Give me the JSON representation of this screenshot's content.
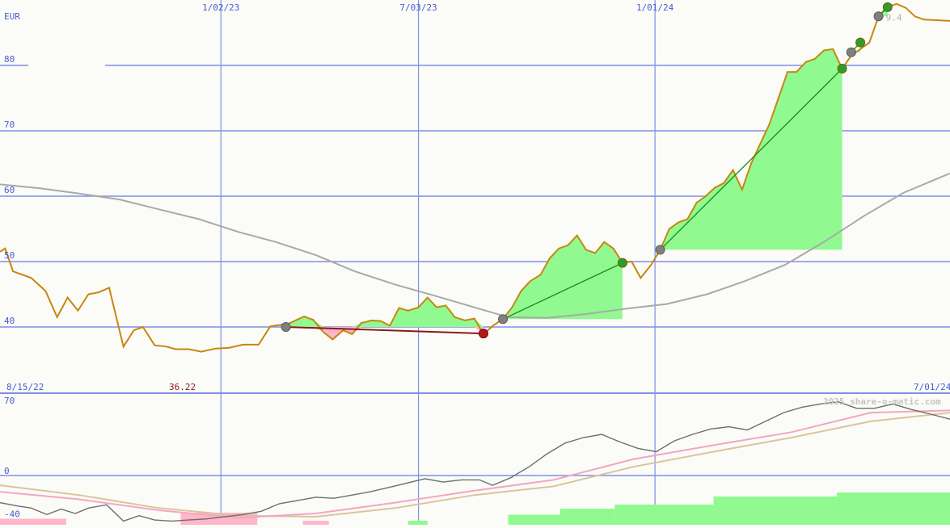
{
  "header": {
    "currency": "EUR",
    "watermark": "2025 share-o-matic.com"
  },
  "colors": {
    "grid": "#7f8fe6",
    "price": "#c8860f",
    "ma": "#a9a9a9",
    "gain_fill": "#90fa90",
    "loss_fill": "#ffb6c8",
    "gain_line": "#1a8a1a",
    "loss_line": "#8b1a1a",
    "osc_main": "#6e6e6e",
    "osc_pink": "#f4a6c0",
    "osc_tan": "#dcc49a",
    "hist_pos": "#90fa90",
    "hist_neg": "#ffb6c8",
    "label_red": "#8b1a1a"
  },
  "chart_data": [
    {
      "type": "line",
      "title": "",
      "ylabel": "EUR",
      "ylim": [
        30,
        90
      ],
      "y_ticks": [
        40,
        50,
        60,
        70,
        80
      ],
      "x_range": [
        "2022-08-15",
        "2024-08-15"
      ],
      "x_ticks": [
        {
          "date": "2023-02-01",
          "label": "1/02/23"
        },
        {
          "date": "2023-07-03",
          "label": "7/03/23"
        },
        {
          "date": "2024-01-01",
          "label": "1/01/24"
        }
      ],
      "bottom_labels": {
        "start": "8/15/22",
        "low": "36.22",
        "end": "7/01/24"
      },
      "top_right_partial_label": "9.4",
      "grid": true,
      "series": [
        {
          "role": "price",
          "points": [
            [
              "2022-08-15",
              51.5
            ],
            [
              "2022-08-19",
              52.0
            ],
            [
              "2022-08-25",
              48.5
            ],
            [
              "2022-09-08",
              47.5
            ],
            [
              "2022-09-19",
              45.5
            ],
            [
              "2022-09-28",
              41.5
            ],
            [
              "2022-10-06",
              44.5
            ],
            [
              "2022-10-14",
              42.5
            ],
            [
              "2022-10-22",
              45.0
            ],
            [
              "2022-10-30",
              45.3
            ],
            [
              "2022-11-07",
              46.0
            ],
            [
              "2022-11-18",
              37.0
            ],
            [
              "2022-11-26",
              39.5
            ],
            [
              "2022-12-03",
              40.0
            ],
            [
              "2022-12-12",
              37.2
            ],
            [
              "2022-12-21",
              37.0
            ],
            [
              "2022-12-28",
              36.6
            ],
            [
              "2023-01-07",
              36.6
            ],
            [
              "2023-01-17",
              36.22
            ],
            [
              "2023-01-28",
              36.7
            ],
            [
              "2023-02-07",
              36.8
            ],
            [
              "2023-02-18",
              37.3
            ],
            [
              "2023-03-02",
              37.3
            ],
            [
              "2023-03-11",
              40.1
            ],
            [
              "2023-03-25",
              40.5
            ],
            [
              "2023-04-06",
              41.6
            ],
            [
              "2023-04-13",
              41.1
            ],
            [
              "2023-04-21",
              39.2
            ],
            [
              "2023-04-28",
              38.1
            ],
            [
              "2023-05-06",
              39.5
            ],
            [
              "2023-05-13",
              38.9
            ],
            [
              "2023-05-20",
              40.6
            ],
            [
              "2023-05-28",
              41.0
            ],
            [
              "2023-06-04",
              40.9
            ],
            [
              "2023-06-11",
              40.2
            ],
            [
              "2023-06-18",
              42.9
            ],
            [
              "2023-06-25",
              42.5
            ],
            [
              "2023-07-03",
              43.0
            ],
            [
              "2023-07-10",
              44.5
            ],
            [
              "2023-07-17",
              43.0
            ],
            [
              "2023-07-24",
              43.3
            ],
            [
              "2023-07-31",
              41.5
            ],
            [
              "2023-08-08",
              41.0
            ],
            [
              "2023-08-15",
              41.3
            ],
            [
              "2023-08-22",
              38.9
            ],
            [
              "2023-08-30",
              40.3
            ],
            [
              "2023-09-06",
              41.2
            ],
            [
              "2023-09-13",
              43.0
            ],
            [
              "2023-09-20",
              45.5
            ],
            [
              "2023-09-27",
              47.0
            ],
            [
              "2023-10-05",
              48.0
            ],
            [
              "2023-10-12",
              50.5
            ],
            [
              "2023-10-19",
              52.0
            ],
            [
              "2023-10-26",
              52.5
            ],
            [
              "2023-11-02",
              54.0
            ],
            [
              "2023-11-09",
              51.8
            ],
            [
              "2023-11-16",
              51.3
            ],
            [
              "2023-11-23",
              53.0
            ],
            [
              "2023-11-30",
              52.0
            ],
            [
              "2023-12-07",
              49.8
            ],
            [
              "2023-12-14",
              50.0
            ],
            [
              "2023-12-21",
              47.5
            ],
            [
              "2023-12-29",
              49.5
            ],
            [
              "2024-01-05",
              51.8
            ],
            [
              "2024-01-12",
              55.0
            ],
            [
              "2024-01-19",
              56.0
            ],
            [
              "2024-01-26",
              56.5
            ],
            [
              "2024-02-02",
              59.0
            ],
            [
              "2024-02-09",
              60.0
            ],
            [
              "2024-02-16",
              61.3
            ],
            [
              "2024-02-23",
              62.0
            ],
            [
              "2024-03-01",
              64.0
            ],
            [
              "2024-03-08",
              61.0
            ],
            [
              "2024-03-15",
              65.0
            ],
            [
              "2024-03-22",
              68.0
            ],
            [
              "2024-03-29",
              71.0
            ],
            [
              "2024-04-05",
              75.0
            ],
            [
              "2024-04-12",
              79.0
            ],
            [
              "2024-04-19",
              79.0
            ],
            [
              "2024-04-26",
              80.5
            ],
            [
              "2024-05-03",
              81.0
            ],
            [
              "2024-05-10",
              82.3
            ],
            [
              "2024-05-17",
              82.5
            ],
            [
              "2024-05-24",
              79.5
            ],
            [
              "2024-05-31",
              81.5
            ],
            [
              "2024-06-07",
              82.5
            ],
            [
              "2024-06-14",
              83.5
            ],
            [
              "2024-06-21",
              87.5
            ],
            [
              "2024-06-28",
              89.0
            ],
            [
              "2024-07-05",
              89.4
            ],
            [
              "2024-07-12",
              88.8
            ],
            [
              "2024-07-19",
              87.5
            ],
            [
              "2024-07-26",
              87.0
            ],
            [
              "2024-08-15",
              86.8
            ]
          ]
        },
        {
          "role": "moving_average",
          "points": [
            [
              "2022-08-15",
              61.8
            ],
            [
              "2022-09-15",
              61.2
            ],
            [
              "2022-10-15",
              60.4
            ],
            [
              "2022-11-15",
              59.5
            ],
            [
              "2022-12-15",
              58.0
            ],
            [
              "2023-01-15",
              56.5
            ],
            [
              "2023-02-15",
              54.5
            ],
            [
              "2023-03-15",
              53.0
            ],
            [
              "2023-04-15",
              51.0
            ],
            [
              "2023-05-15",
              48.5
            ],
            [
              "2023-06-15",
              46.5
            ],
            [
              "2023-07-15",
              44.8
            ],
            [
              "2023-08-15",
              43.0
            ],
            [
              "2023-09-10",
              41.5
            ],
            [
              "2023-10-10",
              41.4
            ],
            [
              "2023-11-10",
              42.0
            ],
            [
              "2023-12-10",
              42.8
            ],
            [
              "2024-01-10",
              43.5
            ],
            [
              "2024-02-10",
              45.0
            ],
            [
              "2024-03-10",
              47.0
            ],
            [
              "2024-04-10",
              49.5
            ],
            [
              "2024-05-10",
              53.0
            ],
            [
              "2024-06-10",
              57.0
            ],
            [
              "2024-07-10",
              60.5
            ],
            [
              "2024-08-15",
              63.5
            ]
          ]
        }
      ],
      "trades": [
        {
          "start": [
            "2023-03-23",
            40.0
          ],
          "end": [
            "2023-08-22",
            39.0
          ],
          "result": "loss"
        },
        {
          "start": [
            "2023-09-06",
            41.2
          ],
          "end": [
            "2023-12-07",
            49.8
          ],
          "result": "gain"
        },
        {
          "start": [
            "2024-01-05",
            51.8
          ],
          "end": [
            "2024-05-24",
            79.5
          ],
          "result": "gain"
        },
        {
          "start": [
            "2024-05-31",
            82.0
          ],
          "end": [
            "2024-06-07",
            83.5
          ],
          "result": "gain"
        },
        {
          "start": [
            "2024-06-21",
            87.5
          ],
          "end": [
            "2024-06-28",
            88.9
          ],
          "result": "gain"
        }
      ]
    },
    {
      "type": "line",
      "title": "",
      "ylim": [
        -40,
        70
      ],
      "y_ticks": [
        -40,
        0,
        70
      ],
      "x_range": [
        "2022-08-15",
        "2024-08-15"
      ],
      "series": [
        {
          "role": "oscillator",
          "points": [
            [
              "2022-08-15",
              -25
            ],
            [
              "2022-08-28",
              -28
            ],
            [
              "2022-09-08",
              -30
            ],
            [
              "2022-09-20",
              -36
            ],
            [
              "2022-10-01",
              -31
            ],
            [
              "2022-10-12",
              -35
            ],
            [
              "2022-10-22",
              -30
            ],
            [
              "2022-11-05",
              -27
            ],
            [
              "2022-11-18",
              -42
            ],
            [
              "2022-11-30",
              -37
            ],
            [
              "2022-12-12",
              -41
            ],
            [
              "2022-12-25",
              -42
            ],
            [
              "2023-01-07",
              -41
            ],
            [
              "2023-01-21",
              -40
            ],
            [
              "2023-02-04",
              -38
            ],
            [
              "2023-02-18",
              -36
            ],
            [
              "2023-03-04",
              -33
            ],
            [
              "2023-03-18",
              -26
            ],
            [
              "2023-04-01",
              -23
            ],
            [
              "2023-04-15",
              -20
            ],
            [
              "2023-04-29",
              -21
            ],
            [
              "2023-05-13",
              -18
            ],
            [
              "2023-05-27",
              -15
            ],
            [
              "2023-06-10",
              -11
            ],
            [
              "2023-06-24",
              -7
            ],
            [
              "2023-07-08",
              -3
            ],
            [
              "2023-07-22",
              -6
            ],
            [
              "2023-08-05",
              -4
            ],
            [
              "2023-08-19",
              -4
            ],
            [
              "2023-08-29",
              -9
            ],
            [
              "2023-09-12",
              -2
            ],
            [
              "2023-09-26",
              8
            ],
            [
              "2023-10-10",
              20
            ],
            [
              "2023-10-24",
              30
            ],
            [
              "2023-11-07",
              35
            ],
            [
              "2023-11-21",
              38
            ],
            [
              "2023-12-05",
              31
            ],
            [
              "2023-12-19",
              25
            ],
            [
              "2024-01-02",
              22
            ],
            [
              "2024-01-16",
              32
            ],
            [
              "2024-01-30",
              38
            ],
            [
              "2024-02-13",
              43
            ],
            [
              "2024-02-27",
              45
            ],
            [
              "2024-03-12",
              42
            ],
            [
              "2024-03-26",
              50
            ],
            [
              "2024-04-09",
              58
            ],
            [
              "2024-04-23",
              63
            ],
            [
              "2024-05-07",
              66
            ],
            [
              "2024-05-21",
              68
            ],
            [
              "2024-06-04",
              62
            ],
            [
              "2024-06-18",
              62
            ],
            [
              "2024-07-02",
              66
            ],
            [
              "2024-07-16",
              61
            ],
            [
              "2024-07-30",
              57
            ],
            [
              "2024-08-15",
              52
            ]
          ]
        },
        {
          "role": "signal_pink",
          "points": [
            [
              "2022-08-15",
              -15
            ],
            [
              "2022-10-15",
              -22
            ],
            [
              "2022-12-15",
              -32
            ],
            [
              "2023-02-15",
              -39
            ],
            [
              "2023-04-15",
              -35
            ],
            [
              "2023-06-15",
              -25
            ],
            [
              "2023-08-15",
              -14
            ],
            [
              "2023-10-15",
              -4
            ],
            [
              "2023-12-15",
              15
            ],
            [
              "2024-02-15",
              28
            ],
            [
              "2024-04-15",
              40
            ],
            [
              "2024-06-15",
              58
            ],
            [
              "2024-08-15",
              60
            ]
          ]
        },
        {
          "role": "signal_tan",
          "points": [
            [
              "2022-08-15",
              -9
            ],
            [
              "2022-10-15",
              -18
            ],
            [
              "2022-12-15",
              -30
            ],
            [
              "2023-02-15",
              -37
            ],
            [
              "2023-04-15",
              -38
            ],
            [
              "2023-06-15",
              -30
            ],
            [
              "2023-08-15",
              -18
            ],
            [
              "2023-10-15",
              -10
            ],
            [
              "2023-12-15",
              8
            ],
            [
              "2024-02-15",
              22
            ],
            [
              "2024-04-15",
              35
            ],
            [
              "2024-06-15",
              50
            ],
            [
              "2024-08-15",
              58
            ]
          ]
        }
      ],
      "histogram": [
        {
          "start": "2022-08-15",
          "end": "2022-10-05",
          "value": -3
        },
        {
          "start": "2023-01-01",
          "end": "2023-03-01",
          "value": -6
        },
        {
          "start": "2023-04-05",
          "end": "2023-04-25",
          "value": -2
        },
        {
          "start": "2023-06-25",
          "end": "2023-07-10",
          "value": 2
        },
        {
          "start": "2023-09-10",
          "end": "2023-10-20",
          "value": 5
        },
        {
          "start": "2023-10-20",
          "end": "2023-12-01",
          "value": 8
        },
        {
          "start": "2023-12-01",
          "end": "2024-02-15",
          "value": 10
        },
        {
          "start": "2024-02-15",
          "end": "2024-05-20",
          "value": 14
        },
        {
          "start": "2024-05-20",
          "end": "2024-08-15",
          "value": 16
        }
      ]
    }
  ]
}
